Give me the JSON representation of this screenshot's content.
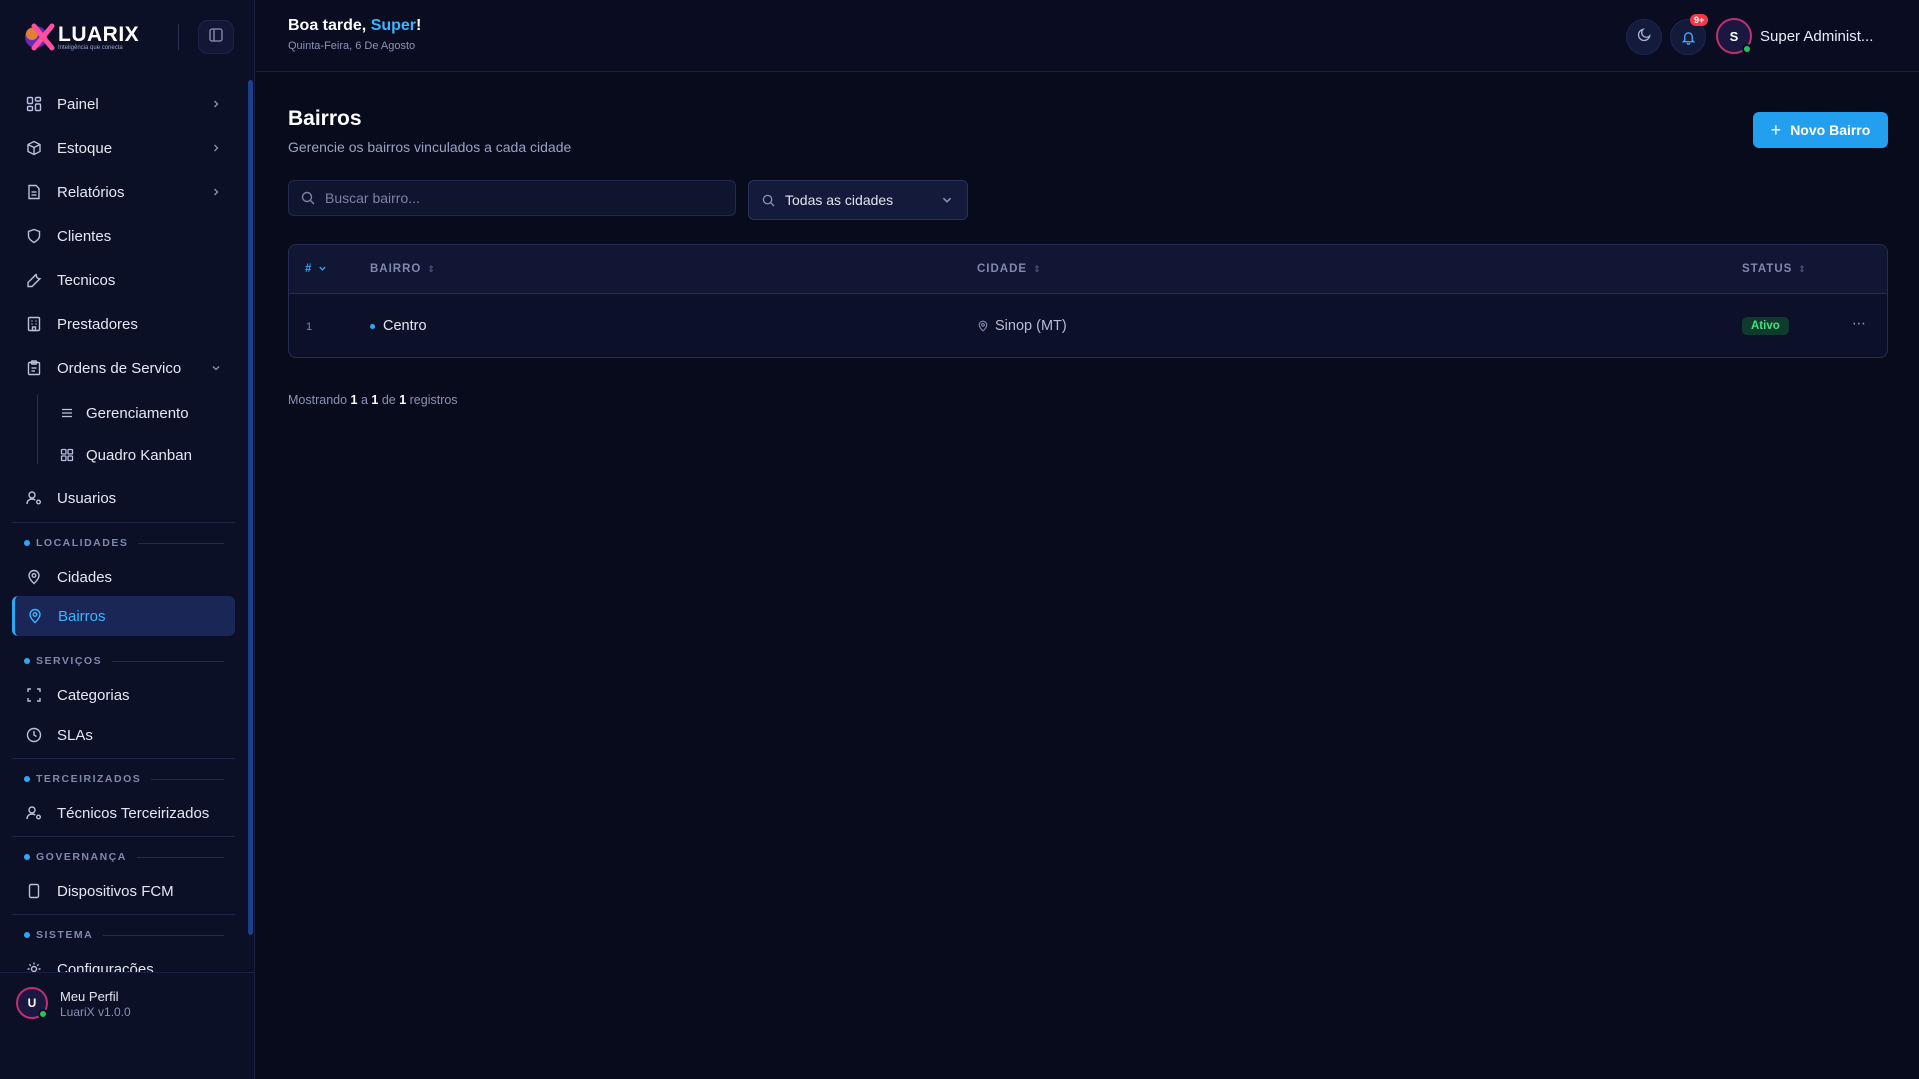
{
  "brand": {
    "name": "LUARIX",
    "tagline": "Inteligência que conecta"
  },
  "sidebar": {
    "items": [
      {
        "label": "Painel"
      },
      {
        "label": "Estoque"
      },
      {
        "label": "Relatórios"
      },
      {
        "label": "Clientes"
      },
      {
        "label": "Tecnicos"
      },
      {
        "label": "Prestadores"
      },
      {
        "label": "Ordens de Servico"
      },
      {
        "label": "Usuarios"
      }
    ],
    "subitems": [
      {
        "label": "Gerenciamento"
      },
      {
        "label": "Quadro Kanban"
      }
    ],
    "sections": [
      {
        "label": "LOCALIDADES",
        "items": [
          {
            "label": "Cidades"
          },
          {
            "label": "Bairros"
          }
        ]
      },
      {
        "label": "SERVIÇOS",
        "items": [
          {
            "label": "Categorias"
          },
          {
            "label": "SLAs"
          }
        ]
      },
      {
        "label": "TERCEIRIZADOS",
        "items": [
          {
            "label": "Técnicos Terceirizados"
          }
        ]
      },
      {
        "label": "GOVERNANÇA",
        "items": [
          {
            "label": "Dispositivos FCM"
          }
        ]
      },
      {
        "label": "SISTEMA",
        "items": [
          {
            "label": "Configurações"
          }
        ]
      }
    ],
    "active_item": "Bairros",
    "profile": {
      "initial": "U",
      "name": "Meu Perfil",
      "version": "LuariX v1.0.0"
    }
  },
  "header": {
    "greeting_prefix": "Boa tarde, ",
    "greeting_name": "Super",
    "greeting_suffix": "!",
    "date": "Quinta-Feira, 6 De Agosto",
    "notification_badge": "9+",
    "user_initial": "S",
    "user_name": "Super Administ..."
  },
  "main": {
    "title": "Bairros",
    "subtitle": "Gerencie os bairros vinculados a cada cidade",
    "new_button": "Novo Bairro",
    "search_placeholder": "Buscar bairro...",
    "city_filter": "Todas as cidades",
    "table": {
      "columns": [
        "#",
        "BAIRRO",
        "CIDADE",
        "STATUS"
      ],
      "rows": [
        {
          "num": "1",
          "bairro": "Centro",
          "cidade": "Sinop (MT)",
          "status": "Ativo"
        }
      ]
    },
    "footer": {
      "prefix": "Mostrando ",
      "from": "1",
      "sep1": " a ",
      "to": "1",
      "sep2": " de ",
      "total": "1",
      "suffix": " registros"
    }
  },
  "colors": {
    "accent": "#2ea8f5",
    "background": "#080b1c",
    "sidebar": "#0c1027",
    "status_active": "#4ade80"
  }
}
